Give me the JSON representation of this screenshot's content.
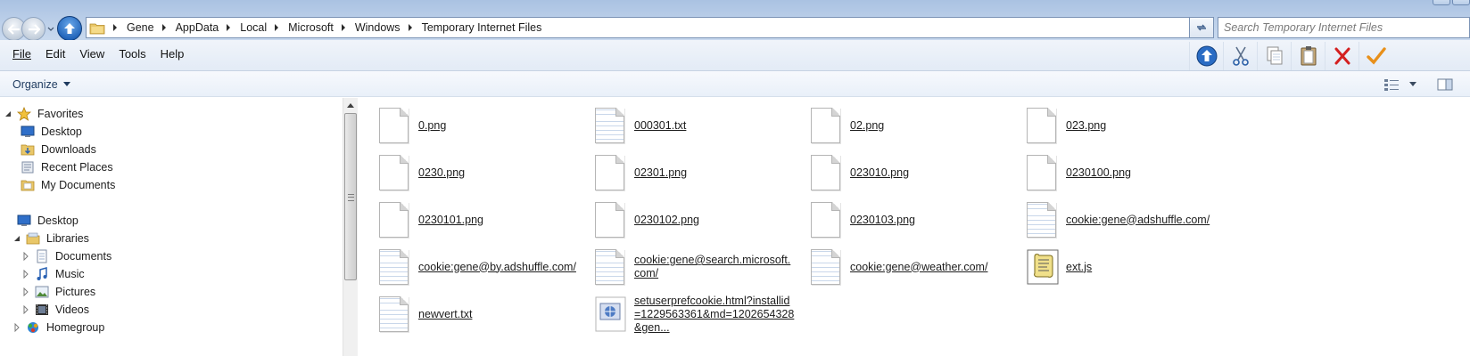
{
  "address": {
    "breadcrumbs": [
      "Gene",
      "AppData",
      "Local",
      "Microsoft",
      "Windows",
      "Temporary Internet Files"
    ]
  },
  "search": {
    "placeholder": "Search Temporary Internet Files"
  },
  "menu": {
    "file": "File",
    "edit": "Edit",
    "view": "View",
    "tools": "Tools",
    "help": "Help"
  },
  "toolbar": {
    "icons": [
      "up-arrow-icon",
      "cut-icon",
      "copy-icon",
      "paste-icon",
      "delete-icon",
      "properties-checkmark-icon"
    ]
  },
  "command": {
    "organize": "Organize"
  },
  "nav": {
    "favorites": "Favorites",
    "desktop_fav": "Desktop",
    "downloads": "Downloads",
    "recent_places": "Recent Places",
    "my_documents": "My Documents",
    "desktop": "Desktop",
    "libraries": "Libraries",
    "documents": "Documents",
    "music": "Music",
    "pictures": "Pictures",
    "videos": "Videos",
    "homegroup": "Homegroup"
  },
  "files": [
    {
      "name": "0.png",
      "icon": "blank-file-icon"
    },
    {
      "name": "000301.txt",
      "icon": "text-file-icon"
    },
    {
      "name": "02.png",
      "icon": "blank-file-icon"
    },
    {
      "name": "023.png",
      "icon": "blank-file-icon"
    },
    {
      "name": "0230.png",
      "icon": "blank-file-icon"
    },
    {
      "name": "02301.png",
      "icon": "blank-file-icon"
    },
    {
      "name": "023010.png",
      "icon": "blank-file-icon"
    },
    {
      "name": "0230100.png",
      "icon": "blank-file-icon"
    },
    {
      "name": "0230101.png",
      "icon": "blank-file-icon"
    },
    {
      "name": "0230102.png",
      "icon": "blank-file-icon"
    },
    {
      "name": "0230103.png",
      "icon": "blank-file-icon"
    },
    {
      "name": "cookie:gene@adshuffle.com/",
      "icon": "text-file-icon"
    },
    {
      "name": "cookie:gene@by.adshuffle.com/",
      "icon": "text-file-icon"
    },
    {
      "name": "cookie:gene@search.microsoft.com/",
      "icon": "text-file-icon"
    },
    {
      "name": "cookie:gene@weather.com/",
      "icon": "text-file-icon"
    },
    {
      "name": "ext.js",
      "icon": "script-file-icon"
    },
    {
      "name": "newvert.txt",
      "icon": "text-file-icon"
    },
    {
      "name": "setuserprefcookie.html?installid=1229563361&md=1202654328&gen...",
      "icon": "html-file-icon"
    }
  ],
  "colors": {
    "titlebar": "#bed1ea",
    "accent_blue": "#1f62b8",
    "delete_red": "#d42020",
    "check_orange": "#e8901a"
  }
}
